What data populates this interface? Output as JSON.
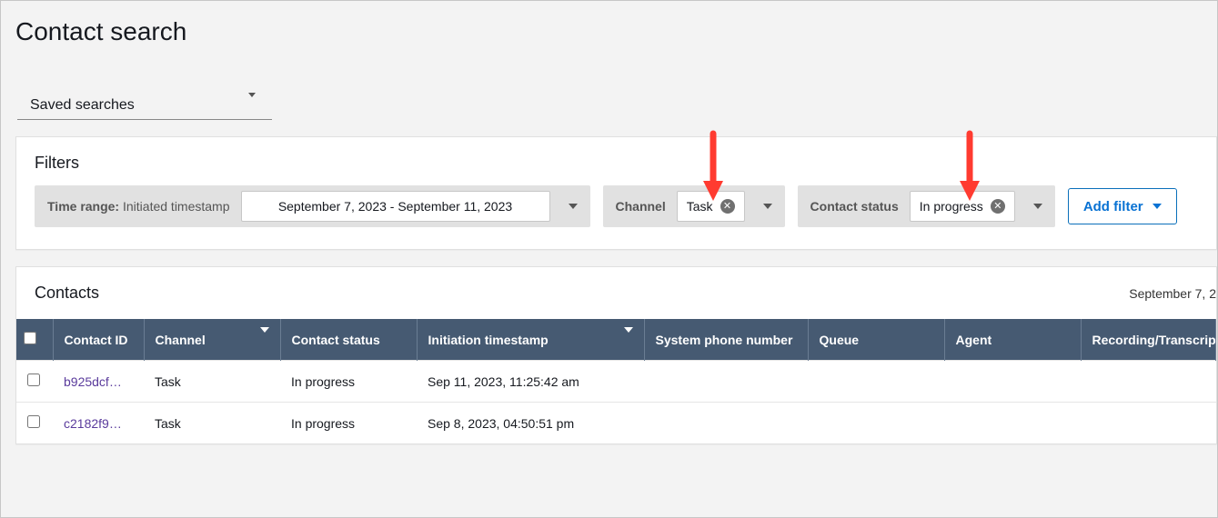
{
  "page_title": "Contact search",
  "saved_searches": {
    "label": "Saved searches"
  },
  "filters": {
    "section_title": "Filters",
    "time_range": {
      "label": "Time range:",
      "sublabel": " Initiated timestamp",
      "value": "September 7, 2023 - September 11, 2023"
    },
    "channel": {
      "label": "Channel",
      "chip": "Task"
    },
    "contact_status": {
      "label": "Contact status",
      "chip": "In progress"
    },
    "add_filter_label": "Add filter"
  },
  "contacts": {
    "section_title": "Contacts",
    "date_summary": "September 7, 2",
    "columns": {
      "contact_id": "Contact ID",
      "channel": "Channel",
      "contact_status": "Contact status",
      "initiation_ts": "Initiation timestamp",
      "system_phone": "System phone number",
      "queue": "Queue",
      "agent": "Agent",
      "recording": "Recording/Transcrip"
    },
    "rows": [
      {
        "contact_id": "b925dcf…",
        "channel": "Task",
        "contact_status": "In progress",
        "initiation_ts": "Sep 11, 2023, 11:25:42 am",
        "system_phone": "",
        "queue": "",
        "agent": "",
        "recording": ""
      },
      {
        "contact_id": "c2182f9…",
        "channel": "Task",
        "contact_status": "In progress",
        "initiation_ts": "Sep 8, 2023, 04:50:51 pm",
        "system_phone": "",
        "queue": "",
        "agent": "",
        "recording": ""
      }
    ]
  }
}
